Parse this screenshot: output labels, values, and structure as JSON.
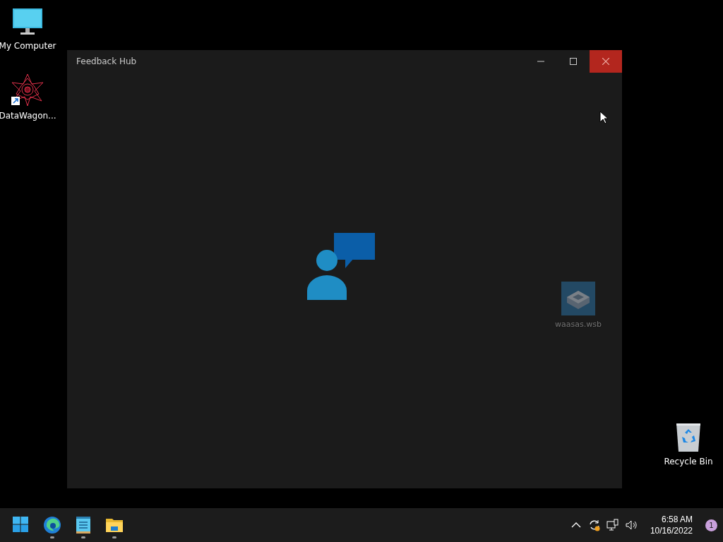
{
  "desktop_icons": [
    {
      "kind": "computer",
      "label": "My Computer"
    },
    {
      "kind": "shortcut-art",
      "label": "DataWagon..."
    },
    {
      "kind": "sandbox",
      "label": "waasas.wsb",
      "dimmed": true
    },
    {
      "kind": "recycle-bin",
      "label": "Recycle Bin"
    }
  ],
  "window": {
    "title": "Feedback Hub"
  },
  "taskbar": {
    "apps": [
      {
        "kind": "start",
        "running": false
      },
      {
        "kind": "browser",
        "running": true
      },
      {
        "kind": "notepad",
        "running": true
      },
      {
        "kind": "folder",
        "running": true
      }
    ],
    "tray": [
      {
        "kind": "chevron"
      },
      {
        "kind": "sync"
      },
      {
        "kind": "network"
      },
      {
        "kind": "volume"
      }
    ],
    "clock": {
      "time": "6:58 AM",
      "date": "10/16/2022"
    },
    "notification_count": "1"
  }
}
